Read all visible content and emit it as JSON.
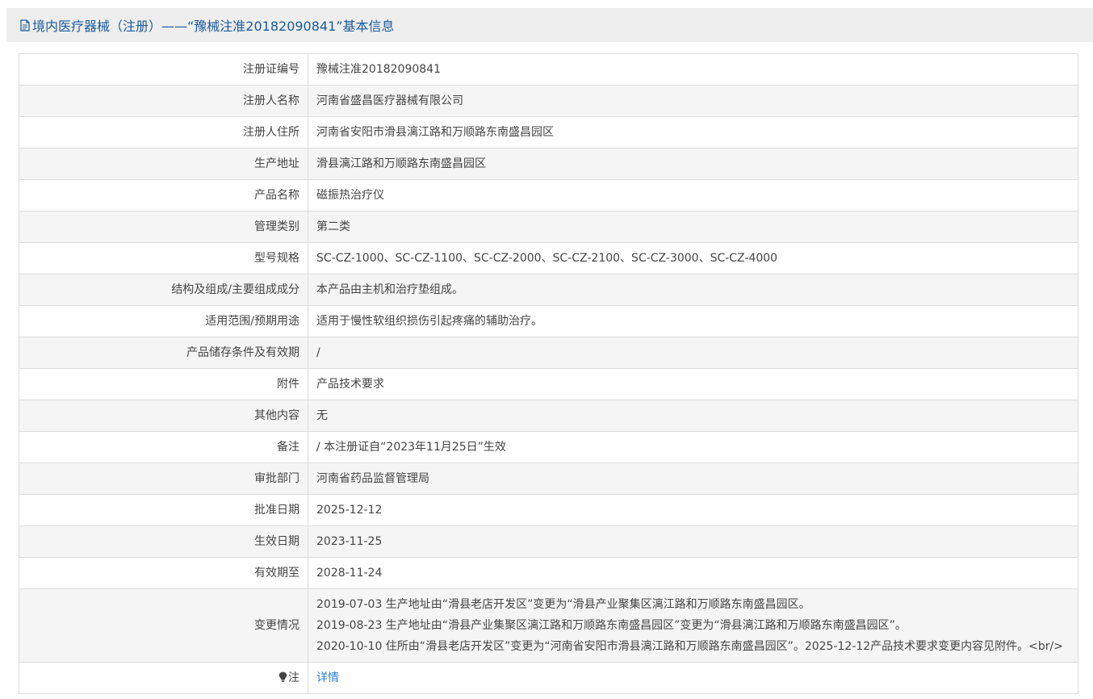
{
  "header": {
    "title": "境内医疗器械（注册）——“豫械注准20182090841”基本信息"
  },
  "rows": [
    {
      "label": "注册证编号",
      "value": "豫械注准20182090841"
    },
    {
      "label": "注册人名称",
      "value": "河南省盛昌医疗器械有限公司"
    },
    {
      "label": "注册人住所",
      "value": "河南省安阳市滑县漓江路和万顺路东南盛昌园区"
    },
    {
      "label": "生产地址",
      "value": "滑县漓江路和万顺路东南盛昌园区"
    },
    {
      "label": "产品名称",
      "value": "磁振热治疗仪"
    },
    {
      "label": "管理类别",
      "value": "第二类"
    },
    {
      "label": "型号规格",
      "value": "SC-CZ-1000、SC-CZ-1100、SC-CZ-2000、SC-CZ-2100、SC-CZ-3000、SC-CZ-4000"
    },
    {
      "label": "结构及组成/主要组成成分",
      "value": "本产品由主机和治疗垫组成。"
    },
    {
      "label": "适用范围/预期用途",
      "value": "适用于慢性软组织损伤引起疼痛的辅助治疗。"
    },
    {
      "label": "产品储存条件及有效期",
      "value": "/"
    },
    {
      "label": "附件",
      "value": "产品技术要求"
    },
    {
      "label": "其他内容",
      "value": "无"
    },
    {
      "label": "备注",
      "value": "/ 本注册证自“2023年11月25日”生效"
    },
    {
      "label": "审批部门",
      "value": "河南省药品监督管理局"
    },
    {
      "label": "批准日期",
      "value": "2025-12-12"
    },
    {
      "label": "生效日期",
      "value": "2023-11-25"
    },
    {
      "label": "有效期至",
      "value": "2028-11-24"
    }
  ],
  "changes": {
    "label": "变更情况",
    "lines": [
      "2019-07-03 生产地址由“滑县老店开发区”变更为“滑县产业聚集区漓江路和万顺路东南盛昌园区。",
      "2019-08-23 生产地址由“滑县产业集聚区漓江路和万顺路东南盛昌园区”变更为“滑县漓江路和万顺路东南盛昌园区”。",
      "2020-10-10 住所由“滑县老店开发区”变更为“河南省安阳市滑县漓江路和万顺路东南盛昌园区”。2025-12-12产品技术要求变更内容见附件。<br/>"
    ]
  },
  "note": {
    "label": "注",
    "link_text": "详情",
    "icon": "lightbulb-icon"
  },
  "colors": {
    "title": "#1a5a9c",
    "link": "#2b7fd4",
    "header_bg": "#eeeeee",
    "alt_row_bg": "#f5f5f5",
    "border": "#dddddd"
  }
}
